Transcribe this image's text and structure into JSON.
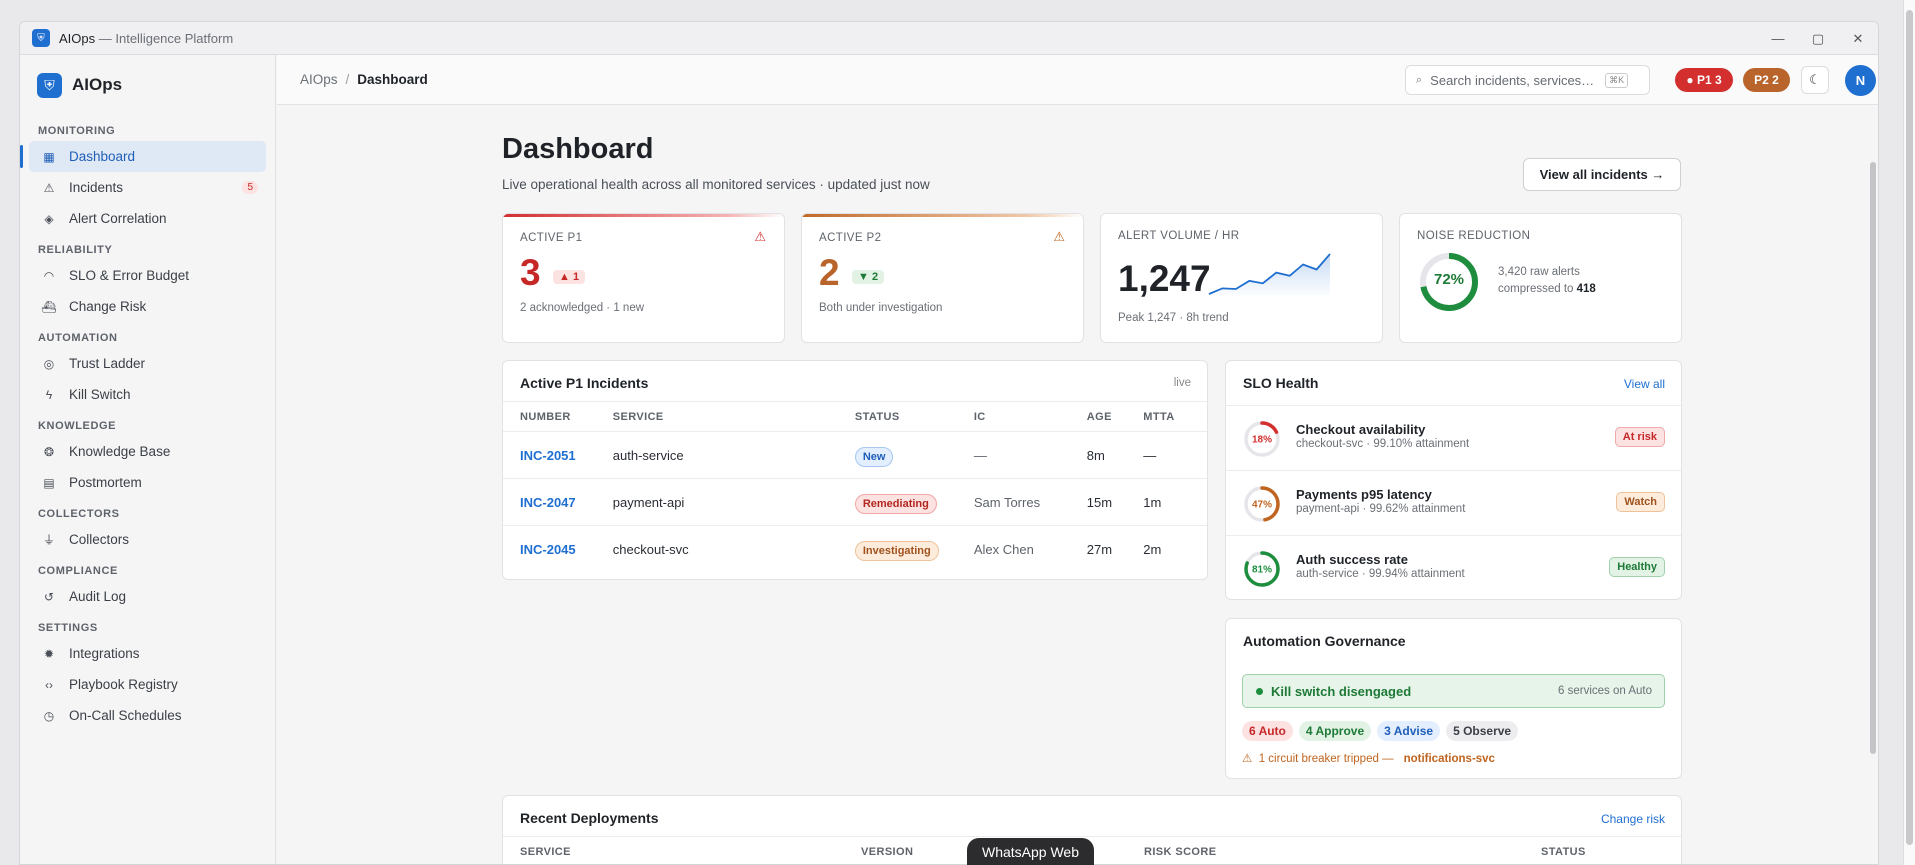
{
  "window": {
    "app": "AIOps",
    "title_suffix": "— Intelligence Platform"
  },
  "brand": {
    "name": "AIOps"
  },
  "sidebar": {
    "groups": [
      {
        "label": "MONITORING",
        "items": [
          {
            "label": "Dashboard",
            "icon": "grid-icon",
            "active": true
          },
          {
            "label": "Incidents",
            "icon": "warning-triangle-icon",
            "badge": "5"
          },
          {
            "label": "Alert Correlation",
            "icon": "layers-icon"
          }
        ]
      },
      {
        "label": "RELIABILITY",
        "items": [
          {
            "label": "SLO & Error Budget",
            "icon": "gauge-icon"
          },
          {
            "label": "Change Risk",
            "icon": "ship-icon"
          }
        ]
      },
      {
        "label": "AUTOMATION",
        "items": [
          {
            "label": "Trust Ladder",
            "icon": "target-icon"
          },
          {
            "label": "Kill Switch",
            "icon": "bolt-icon"
          }
        ]
      },
      {
        "label": "KNOWLEDGE",
        "items": [
          {
            "label": "Knowledge Base",
            "icon": "brain-icon"
          },
          {
            "label": "Postmortem",
            "icon": "document-icon"
          }
        ]
      },
      {
        "label": "COLLECTORS",
        "items": [
          {
            "label": "Collectors",
            "icon": "plug-icon"
          }
        ]
      },
      {
        "label": "COMPLIANCE",
        "items": [
          {
            "label": "Audit Log",
            "icon": "history-icon"
          }
        ]
      },
      {
        "label": "SETTINGS",
        "items": [
          {
            "label": "Integrations",
            "icon": "gear-icon"
          },
          {
            "label": "Playbook Registry",
            "icon": "code-icon"
          },
          {
            "label": "On-Call Schedules",
            "icon": "clock-icon"
          }
        ]
      }
    ]
  },
  "topbar": {
    "breadcrumb": [
      "AIOps",
      "Dashboard"
    ],
    "search_placeholder": "Search incidents, services…",
    "search_shortcut": "⌘K",
    "p1_pill": "● P1 3",
    "p2_pill": "P2 2",
    "avatar": "N"
  },
  "page": {
    "title": "Dashboard",
    "subtitle": "Live operational health across all monitored services · updated just now",
    "view_all_button": "View all incidents →"
  },
  "kpis": {
    "p1": {
      "label": "ACTIVE P1",
      "value": "3",
      "delta": "▲ 1",
      "note": "2 acknowledged · 1 new"
    },
    "p2": {
      "label": "ACTIVE P2",
      "value": "2",
      "delta": "▼ 2",
      "note": "Both under investigation"
    },
    "volume": {
      "label": "ALERT VOLUME / HR",
      "value": "1,247",
      "note": "Peak 1,247 · 8h trend",
      "trend": [
        610,
        700,
        690,
        820,
        780,
        950,
        900,
        1080,
        1000,
        1247
      ]
    },
    "noise": {
      "label": "NOISE REDUCTION",
      "percent": 72,
      "percent_label": "72%",
      "raw_line": "3,420 raw alerts",
      "compressed_prefix": "compressed to",
      "compressed_value": "418"
    }
  },
  "incidents": {
    "title": "Active P1 Incidents",
    "meta": "live",
    "columns": [
      "NUMBER",
      "SERVICE",
      "STATUS",
      "IC",
      "AGE",
      "MTTA"
    ],
    "rows": [
      {
        "number": "INC-2051",
        "service": "auth-service",
        "status": "New",
        "ic": "—",
        "age": "8m",
        "mtta": "—"
      },
      {
        "number": "INC-2047",
        "service": "payment-api",
        "status": "Remediating",
        "ic": "Sam Torres",
        "age": "15m",
        "mtta": "1m"
      },
      {
        "number": "INC-2045",
        "service": "checkout-svc",
        "status": "Investigating",
        "ic": "Alex Chen",
        "age": "27m",
        "mtta": "2m"
      }
    ]
  },
  "slo": {
    "title": "SLO Health",
    "link": "View all",
    "items": [
      {
        "pct": 18,
        "pct_label": "18%",
        "color": "#d32f2f",
        "name": "Checkout availability",
        "sub": "checkout-svc · 99.10% attainment",
        "badge": "At risk"
      },
      {
        "pct": 47,
        "pct_label": "47%",
        "color": "#c0641f",
        "name": "Payments p95 latency",
        "sub": "payment-api · 99.62% attainment",
        "badge": "Watch"
      },
      {
        "pct": 81,
        "pct_label": "81%",
        "color": "#1e8e3e",
        "name": "Auth success rate",
        "sub": "auth-service · 99.94% attainment",
        "badge": "Healthy"
      }
    ]
  },
  "governance": {
    "title": "Automation Governance",
    "kill_switch": "Kill switch disengaged",
    "services_auto": "6 services on Auto",
    "chips": [
      "6 Auto",
      "4 Approve",
      "3 Advise",
      "5 Observe"
    ],
    "breaker_text": "1 circuit breaker tripped —",
    "breaker_service": "notifications-svc"
  },
  "deployments": {
    "title": "Recent Deployments",
    "link": "Change risk",
    "columns": [
      "SERVICE",
      "VERSION",
      "RISK SCORE",
      "STATUS"
    ]
  },
  "toast": "WhatsApp Web",
  "colors": {
    "accent": "#1f6fd1",
    "p1": "#d32f2f",
    "p2": "#b8642a",
    "ok": "#1e8e3e"
  }
}
